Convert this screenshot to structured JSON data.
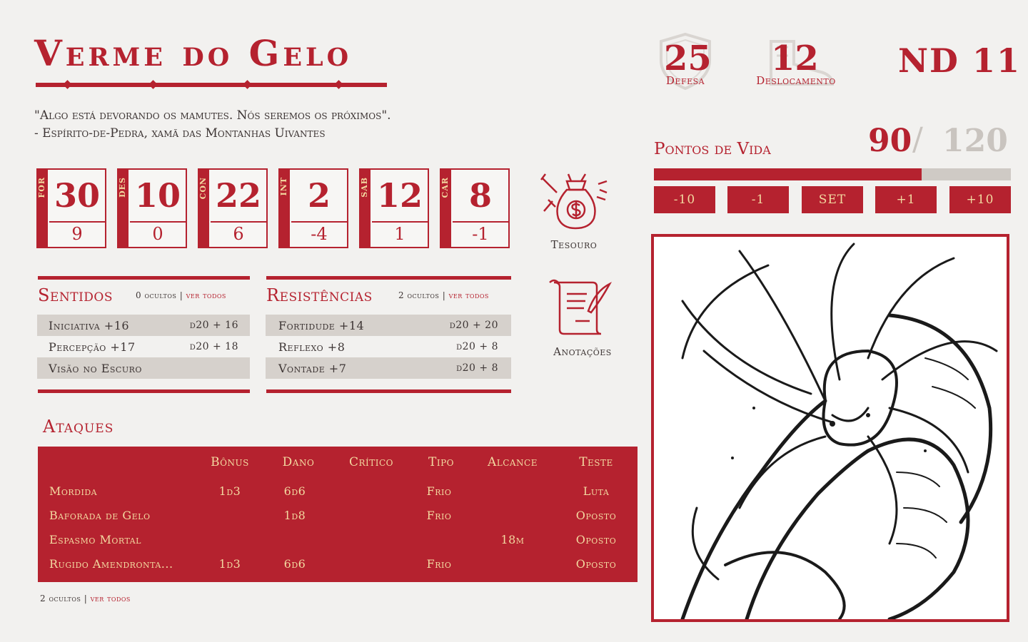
{
  "header": {
    "title": "Verme do Gelo",
    "quote_line1": "\"Algo está devorando os mamutes. Nós seremos os próximos\".",
    "quote_line2": "- Espírito-de-Pedra, xamã das Montanhas Uivantes"
  },
  "stats": {
    "defense_value": "25",
    "defense_label": "Defesa",
    "movement_value": "12",
    "movement_label": "Deslocamento",
    "nd": "ND 11"
  },
  "hp": {
    "label": "Pontos de Vida",
    "current": "90",
    "separator": "/",
    "max": "120",
    "fraction": 0.75,
    "buttons": [
      "-10",
      "-1",
      "SET",
      "+1",
      "+10"
    ]
  },
  "attributes": [
    {
      "abbr": "FOR",
      "value": "30",
      "mod": "9"
    },
    {
      "abbr": "DES",
      "value": "10",
      "mod": "0"
    },
    {
      "abbr": "CON",
      "value": "22",
      "mod": "6"
    },
    {
      "abbr": "INT",
      "value": "2",
      "mod": "-4"
    },
    {
      "abbr": "SAB",
      "value": "12",
      "mod": "1"
    },
    {
      "abbr": "CAR",
      "value": "8",
      "mod": "-1"
    }
  ],
  "side": {
    "treasure_label": "Tesouro",
    "notes_label": "Anotações"
  },
  "senses": {
    "title": "Sentidos",
    "hidden": "0 ocultos",
    "sep": "|",
    "see_all": "ver todos",
    "rows": [
      {
        "name": "Iniciativa +16",
        "roll": "d20 + 16"
      },
      {
        "name": "Percepção +17",
        "roll": "d20 + 18"
      },
      {
        "name": "Visão no Escuro",
        "roll": ""
      }
    ]
  },
  "resistances": {
    "title": "Resistências",
    "hidden": "2 ocultos",
    "sep": "|",
    "see_all": "ver todos",
    "rows": [
      {
        "name": "Fortidude +14",
        "roll": "d20 + 20"
      },
      {
        "name": "Reflexo +8",
        "roll": "d20 + 8"
      },
      {
        "name": "Vontade +7",
        "roll": "d20 + 8"
      }
    ]
  },
  "attacks": {
    "title": "Ataques",
    "headers": [
      "Bônus",
      "Dano",
      "Crítico",
      "Tipo",
      "Alcance",
      "Teste"
    ],
    "rows": [
      {
        "name": "Mordida",
        "bonus": "1d3",
        "damage": "6d6",
        "crit": "",
        "type": "Frio",
        "range": "",
        "test": "Luta"
      },
      {
        "name": "Baforada de Gelo",
        "bonus": "",
        "damage": "1d8",
        "crit": "",
        "type": "Frio",
        "range": "",
        "test": "Oposto"
      },
      {
        "name": "Espasmo Mortal",
        "bonus": "",
        "damage": "",
        "crit": "",
        "type": "",
        "range": "18m",
        "test": "Oposto"
      },
      {
        "name": "Rugido Amendronta...",
        "bonus": "1d3",
        "damage": "6d6",
        "crit": "",
        "type": "Frio",
        "range": "",
        "test": "Oposto"
      }
    ],
    "hidden": "2 ocultos",
    "sep": "|",
    "see_all": "ver todos"
  },
  "colors": {
    "accent": "#b5222f",
    "gold_text": "#f3d9a0",
    "background": "#f2f1ef",
    "row_shade": "#d6d1cc"
  }
}
